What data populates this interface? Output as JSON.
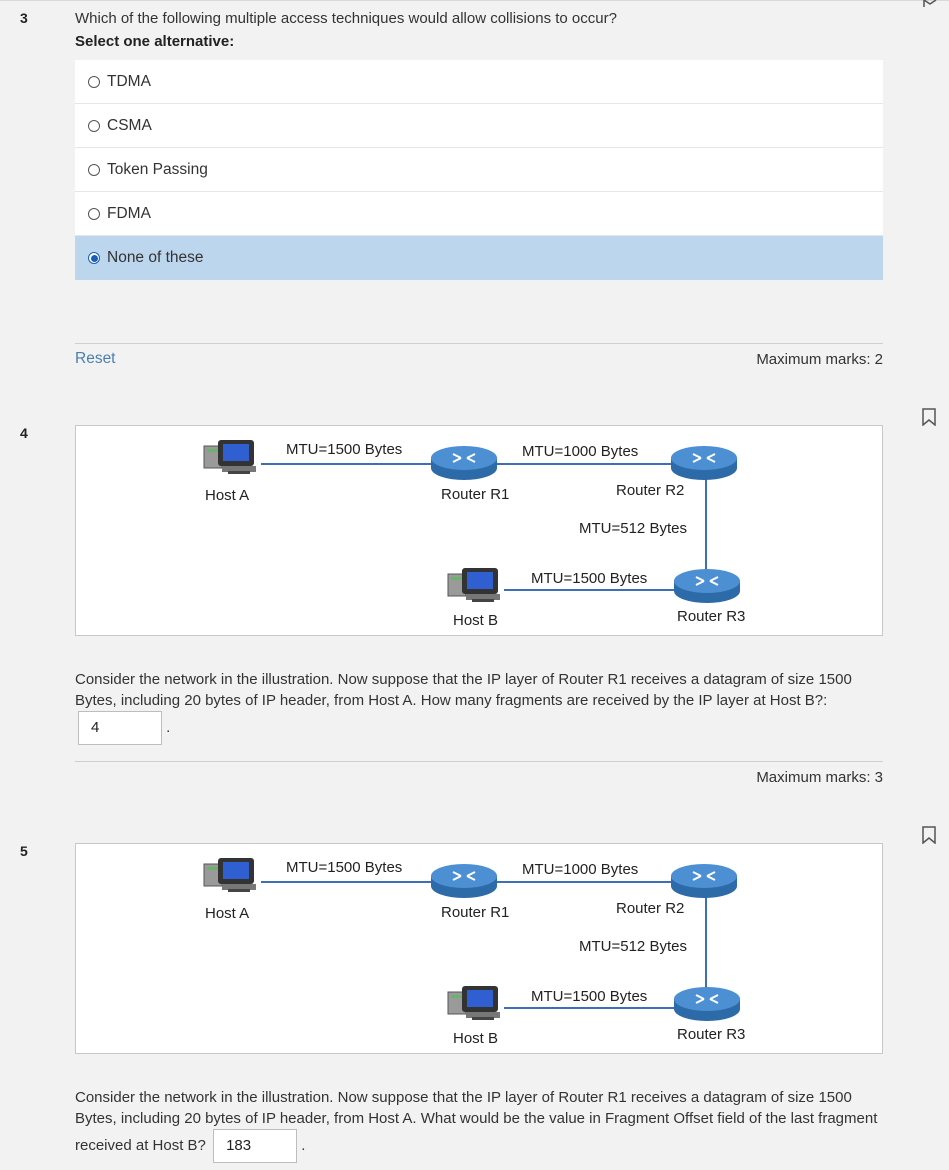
{
  "q3": {
    "number": "3",
    "question": "Which of the following multiple access techniques would allow collisions to occur?",
    "instruction": "Select one alternative:",
    "options": [
      {
        "label": "TDMA",
        "selected": false
      },
      {
        "label": "CSMA",
        "selected": false
      },
      {
        "label": "Token Passing",
        "selected": false
      },
      {
        "label": "FDMA",
        "selected": false
      },
      {
        "label": "None of these",
        "selected": true
      }
    ],
    "reset_label": "Reset",
    "max_marks": "Maximum marks: 2"
  },
  "diagram": {
    "mtu_a_r1": "MTU=1500 Bytes",
    "mtu_r1_r2": "MTU=1000 Bytes",
    "mtu_r2_r3": "MTU=512 Bytes",
    "mtu_r3_b": "MTU=1500 Bytes",
    "host_a": "Host A",
    "router_r1": "Router R1",
    "router_r2": "Router R2",
    "router_r3": "Router R3",
    "host_b": "Host B"
  },
  "q4": {
    "number": "4",
    "text": "Consider the network in the illustration. Now suppose that the IP layer of Router R1 receives a datagram of size 1500 Bytes, including 20 bytes of IP header, from Host A. How many fragments are received by the IP layer at Host B?:",
    "answer": "4",
    "trailing": ".",
    "max_marks": "Maximum marks: 3"
  },
  "q5": {
    "number": "5",
    "text": "Consider the network in the illustration. Now suppose that the IP layer of Router R1 receives a datagram of size 1500 Bytes, including 20 bytes of IP header, from Host A. What would be the value in Fragment Offset field of the last fragment received at Host B?",
    "answer": "183",
    "trailing": "."
  },
  "colors": {
    "selected_bg": "#bcd6ee",
    "link": "#4a7fb0",
    "router": "#3c7fc3"
  },
  "icons": [
    "flag-icon",
    "computer-icon",
    "router-icon",
    "radio-button-icon"
  ]
}
